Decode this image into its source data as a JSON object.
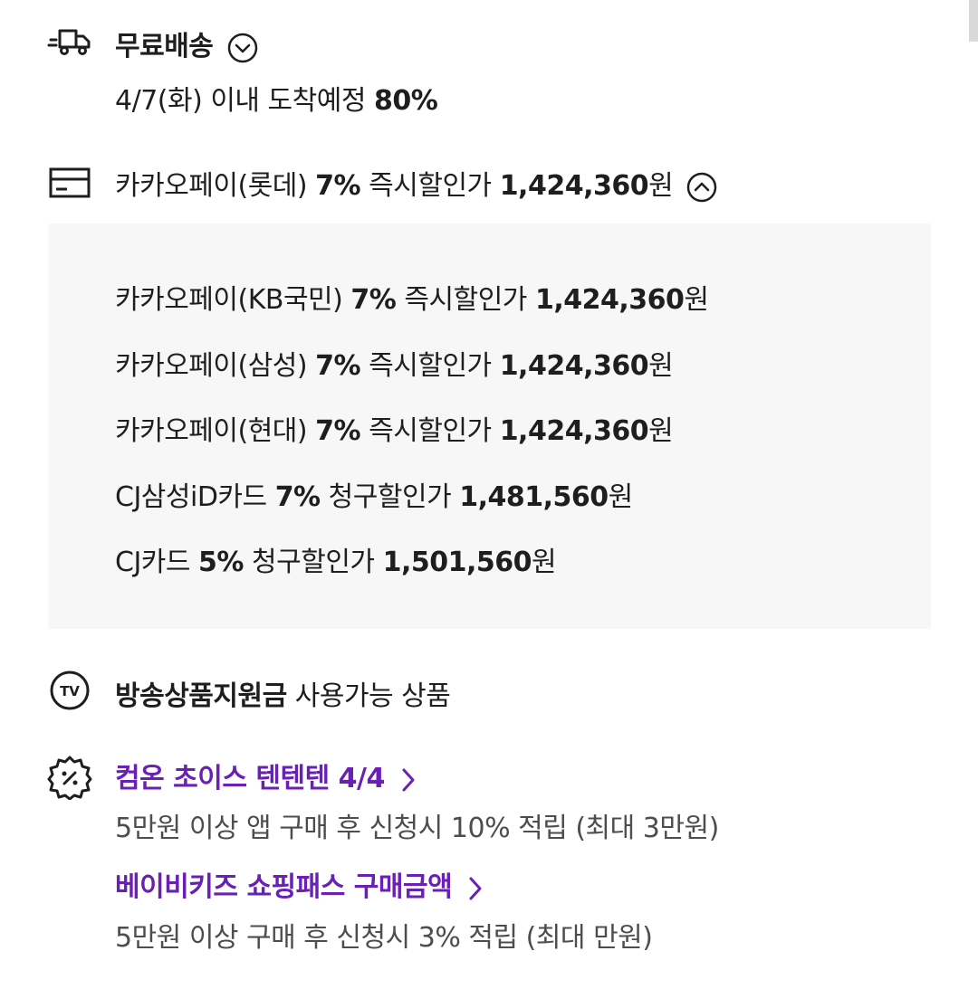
{
  "delivery": {
    "icon": "truck-icon",
    "title": "무료배송",
    "arrival": "4/7(화) 이내 도착예정",
    "arrival_rate": "80%"
  },
  "card_discount": {
    "icon": "card-icon",
    "main": {
      "name": "카카오페이(롯데)",
      "rate": "7%",
      "label": "즉시할인가",
      "price": "1,424,360",
      "unit": "원"
    },
    "details": [
      {
        "name": "카카오페이(KB국민)",
        "rate": "7%",
        "label": "즉시할인가",
        "price": "1,424,360",
        "unit": "원"
      },
      {
        "name": "카카오페이(삼성)",
        "rate": "7%",
        "label": "즉시할인가",
        "price": "1,424,360",
        "unit": "원"
      },
      {
        "name": "카카오페이(현대)",
        "rate": "7%",
        "label": "즉시할인가",
        "price": "1,424,360",
        "unit": "원"
      },
      {
        "name": "CJ삼성iD카드",
        "rate": "7%",
        "label": "청구할인가",
        "price": "1,481,560",
        "unit": "원"
      },
      {
        "name": "CJ카드",
        "rate": "5%",
        "label": "청구할인가",
        "price": "1,501,560",
        "unit": "원"
      }
    ]
  },
  "tv": {
    "icon": "tv-icon",
    "icon_text": "TV",
    "title": "방송상품지원금",
    "desc": "사용가능 상품"
  },
  "promos": {
    "icon": "discount-badge-icon",
    "items": [
      {
        "title": "컴온 초이스 텐텐텐 4/4",
        "desc": "5만원 이상 앱 구매 후 신청시 10% 적립 (최대 3만원)"
      },
      {
        "title": "베이비키즈 쇼핑패스 구매금액",
        "desc": "5만원 이상 구매 후 신청시 3% 적립 (최대 만원)"
      }
    ]
  },
  "colors": {
    "accent": "#6a1fb5",
    "panel_bg": "#f7f7f7",
    "text": "#1e1e1e",
    "sub_text": "#4d4d4d"
  }
}
